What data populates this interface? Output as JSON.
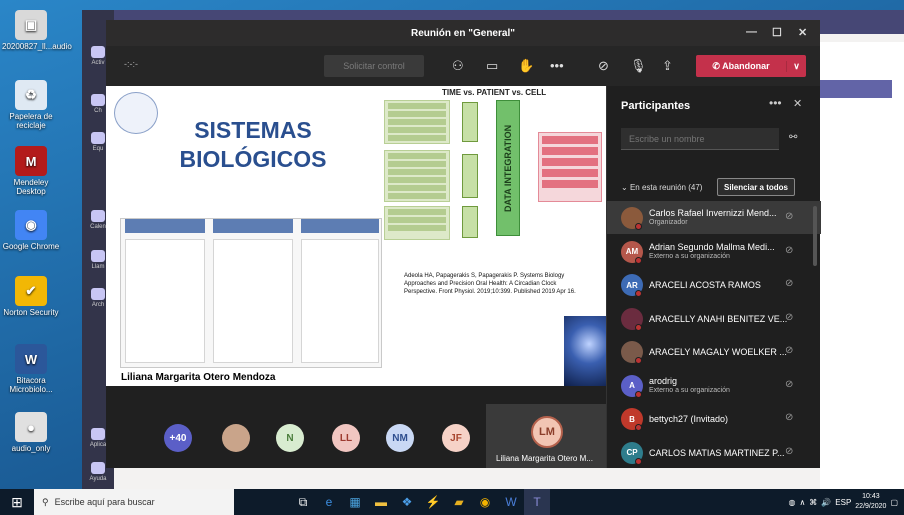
{
  "desktop": {
    "icons": [
      {
        "label": "20200827_ll...audio",
        "glyph": "▣",
        "color": "#d9d9d9"
      },
      {
        "label": "Papelera de reciclaje",
        "glyph": "♻",
        "color": "#dfe9f3"
      },
      {
        "label": "Mendeley Desktop",
        "glyph": "M",
        "color": "#b31b1b"
      },
      {
        "label": "Google Chrome",
        "glyph": "◉",
        "color": "#4285f4"
      },
      {
        "label": "Norton Security",
        "glyph": "✔",
        "color": "#f2b705"
      },
      {
        "label": "Bitacora Microbiolo...",
        "glyph": "W",
        "color": "#2b579a"
      },
      {
        "label": "audio_only",
        "glyph": "●",
        "color": "#e0e0e0"
      }
    ]
  },
  "meeting": {
    "title": "Reunión en \"General\"",
    "timer": "-:-:-",
    "request_control": "Solicitar control",
    "leave_label": "Abandonar",
    "presenter_caption": "Liliana Margarita Otero Mendoza",
    "slide": {
      "title_line1": "SISTEMAS",
      "title_line2": "BIOLÓGICOS",
      "header": "TIME vs. PATIENT vs. CELL",
      "data_integration": "DATA INTEGRATION",
      "citation_line1": "Adeola HA, Papagerakis S, Papagerakis P. Systems Biology",
      "citation_line2": "Approaches and Precision Oral Health: A Circadian Clock",
      "citation_line3": "Perspective. Front Physiol. 2019;10:399. Published 2019 Apr 16."
    },
    "avatars": [
      {
        "label": "+40",
        "bg": "#5b5fc7",
        "fg": "#ffffff"
      },
      {
        "label": "",
        "bg": "#c9a48a",
        "fg": "#ffffff"
      },
      {
        "label": "N",
        "bg": "#d8ecd0",
        "fg": "#4a7d3b"
      },
      {
        "label": "LL",
        "bg": "#f1c6c1",
        "fg": "#9d3a2f"
      },
      {
        "label": "NM",
        "bg": "#c9d8f4",
        "fg": "#2f4f8f"
      },
      {
        "label": "JF",
        "bg": "#f6d2c7",
        "fg": "#a8462f"
      }
    ],
    "speaker_tile": {
      "initials": "LM",
      "name": "Liliana Margarita Otero M..."
    }
  },
  "participants": {
    "title": "Participantes",
    "search_placeholder": "Escribe un nombre",
    "section_label": "En esta reunión (47)",
    "mute_all": "Silenciar a todos",
    "list": [
      {
        "initials": "",
        "name": "Carlos Rafael Invernizzi Mend...",
        "sub": "Organizador",
        "color": "#8b5a3c"
      },
      {
        "initials": "AM",
        "name": "Adrian Segundo Mallma Medi...",
        "sub": "Externo a su organización",
        "color": "#b5574b"
      },
      {
        "initials": "AR",
        "name": "ARACELI ACOSTA RAMOS",
        "sub": "",
        "color": "#3d6bb5"
      },
      {
        "initials": "",
        "name": "ARACELLY ANAHI BENITEZ VE...",
        "sub": "",
        "color": "#6b2c3f"
      },
      {
        "initials": "",
        "name": "ARACELY MAGALY WOELKER ...",
        "sub": "",
        "color": "#7a5a4a"
      },
      {
        "initials": "A",
        "name": "arodrig",
        "sub": "Externo a su organización",
        "color": "#5b5fc7"
      },
      {
        "initials": "B",
        "name": "bettych27 (Invitado)",
        "sub": "",
        "color": "#c0392b"
      },
      {
        "initials": "CP",
        "name": "CARLOS MATIAS MARTINEZ P...",
        "sub": "",
        "color": "#2e7d8c"
      }
    ]
  },
  "taskbar": {
    "search_text": "Escribe aquí para buscar",
    "lang": "ESP",
    "time": "10:43",
    "date": "22/9/2020"
  }
}
